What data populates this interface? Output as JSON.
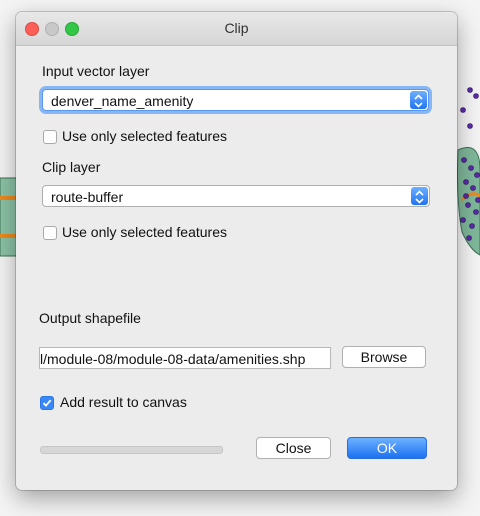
{
  "window": {
    "title": "Clip"
  },
  "input_layer": {
    "label": "Input vector layer",
    "selected": "denver_name_amenity",
    "use_selected_label": "Use only selected features",
    "use_selected_checked": false
  },
  "clip_layer": {
    "label": "Clip layer",
    "selected": "route-buffer",
    "use_selected_label": "Use only selected features",
    "use_selected_checked": false
  },
  "output": {
    "label": "Output shapefile",
    "path": "l/module-08/module-08-data/amenities.shp",
    "browse_label": "Browse"
  },
  "add_result": {
    "label": "Add result to canvas",
    "checked": true
  },
  "progress": {
    "value": 0
  },
  "buttons": {
    "close_label": "Close",
    "ok_label": "OK"
  },
  "colors": {
    "accent": "#1f74f2",
    "map_fill": "#7fb89a",
    "map_points": "#5b2ca8",
    "map_road": "#f0891a"
  }
}
